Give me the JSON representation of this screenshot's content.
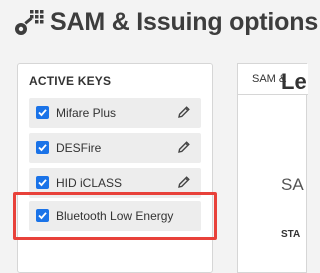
{
  "header": {
    "icon": "key-grid-icon",
    "title": "SAM & Issuing options"
  },
  "active_keys": {
    "heading": "ACTIVE KEYS",
    "items": [
      {
        "label": "Mifare Plus",
        "checked": true,
        "editable": true
      },
      {
        "label": "DESFire",
        "checked": true,
        "editable": true
      },
      {
        "label": "HID iCLASS",
        "checked": true,
        "editable": true
      },
      {
        "label": "Bluetooth Low Energy",
        "checked": true,
        "editable": false,
        "highlighted": true
      }
    ]
  },
  "right_panel": {
    "tab_label": "SAM &",
    "heading": "Le",
    "subheading": "SA",
    "field_label": "STA"
  },
  "colors": {
    "checkbox": "#1a73e8",
    "highlight": "#e8413a",
    "row_bg": "#ededed"
  }
}
